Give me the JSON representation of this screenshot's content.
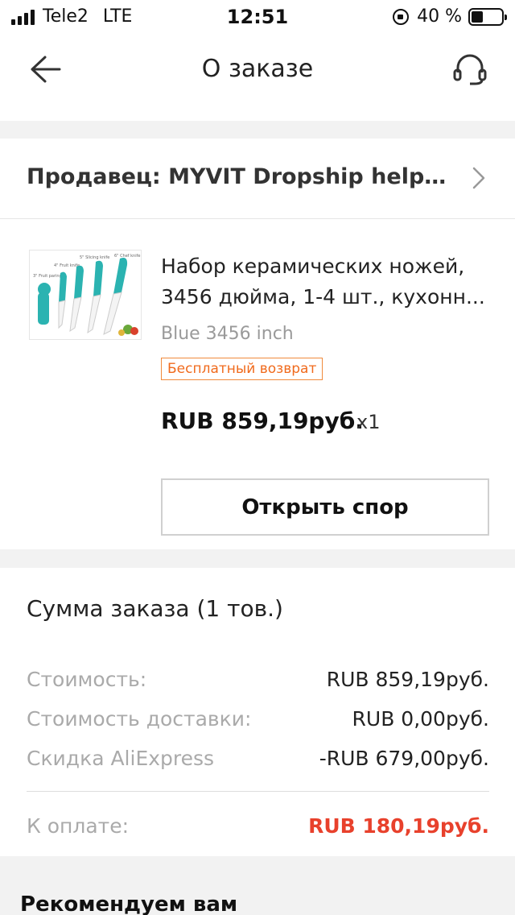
{
  "status_bar": {
    "carrier": "Tele2",
    "network": "LTE",
    "time": "12:51",
    "battery": "40 %",
    "battery_level": 0.4
  },
  "header": {
    "title": "О заказе",
    "back_icon": "arrow-left-icon",
    "support_icon": "headset-icon"
  },
  "seller": {
    "label": "Продавец: MYVIT Dropship helping h..."
  },
  "product": {
    "title": "Набор керамических ножей, 3456 дюйма, 1-4 шт., кухонн...",
    "variant": "Blue 3456 inch",
    "badge": "Бесплатный возврат",
    "price": "RUB 859,19руб.",
    "quantity": "x1",
    "image_labels": [
      "6\" Chef knife",
      "5\" Slicing knife",
      "4\" Fruit knife",
      "3\" Fruit paring"
    ],
    "dispute_button": "Открыть спор"
  },
  "summary": {
    "title": "Сумма заказа (1 тов.)",
    "rows": [
      {
        "label": "Стоимость:",
        "value": "RUB 859,19руб."
      },
      {
        "label": "Стоимость доставки:",
        "value": "RUB 0,00руб."
      },
      {
        "label": "Скидка AliExpress",
        "value": "-RUB 679,00руб."
      }
    ],
    "total_label": "К оплате:",
    "total_value": "RUB 180,19руб."
  },
  "recommend_title": "Рекомендуем вам",
  "colors": {
    "accent_red": "#e8412c",
    "badge_orange": "#f06a1c",
    "knife_teal": "#2bb3b1"
  }
}
